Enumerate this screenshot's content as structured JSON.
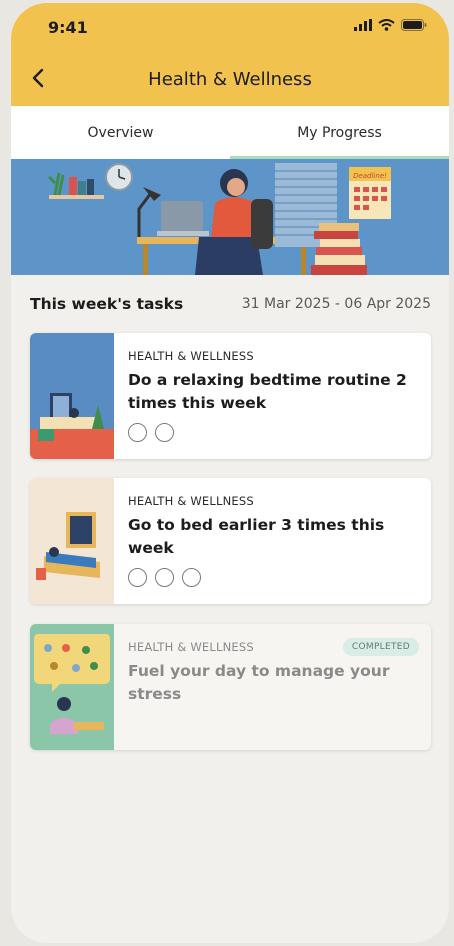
{
  "status": {
    "time": "9:41"
  },
  "header": {
    "title": "Health & Wellness"
  },
  "tabs": [
    {
      "label": "Overview",
      "active": false
    },
    {
      "label": "My Progress",
      "active": true
    }
  ],
  "banner": {
    "calendar_text": "Deadline!"
  },
  "section": {
    "title": "This week's tasks",
    "dates": "31 Mar 2025 - 06 Apr 2025"
  },
  "tasks": [
    {
      "category": "HEALTH & WELLNESS",
      "title": "Do a relaxing bedtime routine 2 times this week",
      "goal": 2,
      "completed_count": 0,
      "completed": false
    },
    {
      "category": "HEALTH & WELLNESS",
      "title": "Go to bed earlier 3 times this week",
      "goal": 3,
      "completed_count": 0,
      "completed": false
    },
    {
      "category": "HEALTH & WELLNESS",
      "title": "Fuel your day to manage your stress",
      "completed": true,
      "badge": "COMPLETED"
    }
  ],
  "colors": {
    "header": "#f2c24f",
    "banner": "#5e95c9",
    "tab_indicator": "#a9dcb7",
    "badge_bg": "#d8ede5"
  }
}
